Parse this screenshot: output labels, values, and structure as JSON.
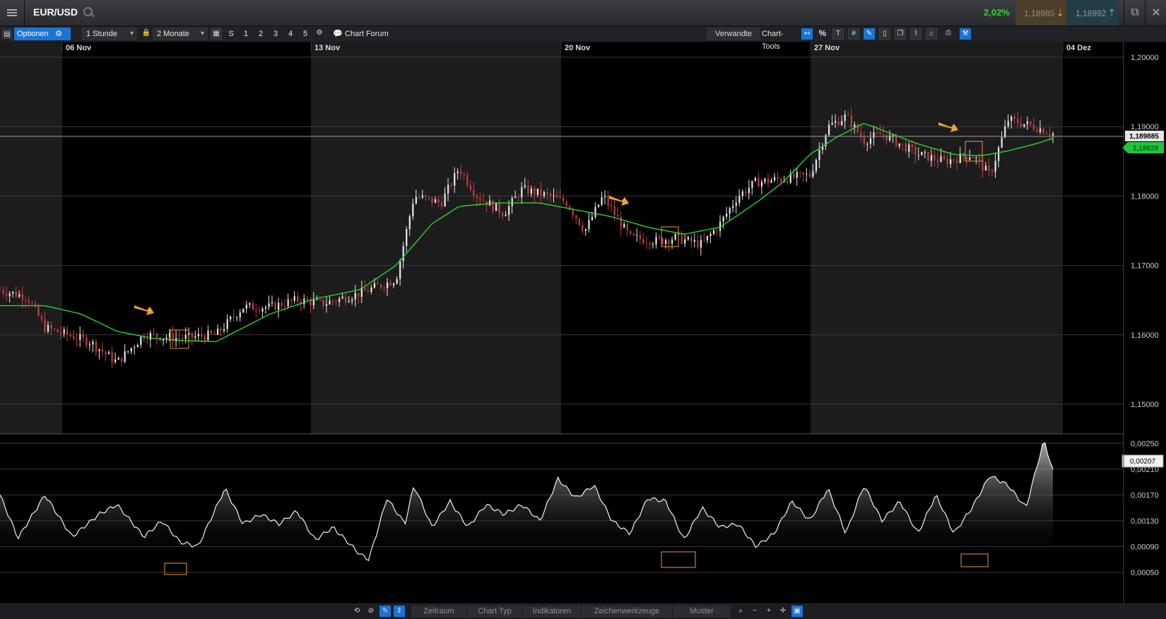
{
  "header": {
    "symbol": "EUR/USD",
    "change_pct": "2,02%",
    "bid": "1,18985",
    "ask": "1,18992"
  },
  "toolbar": {
    "options_label": "Optionen",
    "interval": "1 Stunde",
    "range": "2 Monate",
    "quick_ranges": [
      "S",
      "1",
      "2",
      "3",
      "4",
      "5"
    ],
    "chart_forum": "Chart Forum",
    "related": "Verwandte",
    "chart_tools": "Chart-Tools"
  },
  "bottom": {
    "tabs": [
      "Zeitraum",
      "Chart Typ",
      "Indikatoren",
      "Zeichenwerkzeuge",
      "Muster"
    ]
  },
  "colors": {
    "ma_line": "#2bd42b",
    "up_candle": "#e8e8e8",
    "down_candle": "#c2403f",
    "highlight_box": "#e89a3a",
    "arrow": "#f0a030",
    "accent_blue": "#1a74d6"
  },
  "chart_data": [
    {
      "type": "candlestick",
      "x_ticks": [
        "06 Nov",
        "13 Nov",
        "20 Nov",
        "27 Nov",
        "04 Dez"
      ],
      "y_ticks": [
        "1,20000",
        "1,19000",
        "1,18000",
        "1,17000",
        "1,16000",
        "1,15000"
      ],
      "ylim": [
        1.15,
        1.2
      ],
      "current_price_label": "1,189885",
      "ma_value_label": "1,18829",
      "series": [
        {
          "name": "",
          "approx_path": [
            [
              0,
              1.1664
            ],
            [
              0.03,
              1.1655
            ],
            [
              0.05,
              1.161
            ],
            [
              0.1,
              1.159
            ],
            [
              0.13,
              1.156
            ],
            [
              0.16,
              1.16
            ],
            [
              0.2,
              1.1595
            ],
            [
              0.24,
              1.16
            ],
            [
              0.27,
              1.164
            ],
            [
              0.3,
              1.164
            ],
            [
              0.33,
              1.165
            ],
            [
              0.36,
              1.1645
            ],
            [
              0.4,
              1.166
            ],
            [
              0.44,
              1.168
            ],
            [
              0.46,
              1.18
            ],
            [
              0.49,
              1.179
            ],
            [
              0.51,
              1.184
            ],
            [
              0.53,
              1.18
            ],
            [
              0.56,
              1.1775
            ],
            [
              0.58,
              1.181
            ],
            [
              0.61,
              1.18
            ],
            [
              0.63,
              1.179
            ],
            [
              0.65,
              1.175
            ],
            [
              0.67,
              1.18
            ],
            [
              0.7,
              1.174
            ],
            [
              0.73,
              1.1735
            ],
            [
              0.75,
              1.174
            ],
            [
              0.78,
              1.173
            ],
            [
              0.8,
              1.176
            ],
            [
              0.82,
              1.18
            ],
            [
              0.84,
              1.182
            ],
            [
              0.87,
              1.1825
            ],
            [
              0.9,
              1.183
            ],
            [
              0.92,
              1.19
            ],
            [
              0.94,
              1.1915
            ],
            [
              0.96,
              1.188
            ],
            [
              0.98,
              1.189
            ],
            [
              1.0,
              1.1875
            ],
            [
              1.02,
              1.186
            ],
            [
              1.05,
              1.185
            ],
            [
              1.08,
              1.186
            ],
            [
              1.1,
              1.183
            ],
            [
              1.12,
              1.191
            ],
            [
              1.15,
              1.19
            ],
            [
              1.17,
              1.189
            ]
          ]
        }
      ],
      "ma_path": [
        [
          0,
          1.1642
        ],
        [
          0.05,
          1.1642
        ],
        [
          0.09,
          1.163
        ],
        [
          0.13,
          1.1605
        ],
        [
          0.17,
          1.1595
        ],
        [
          0.2,
          1.1592
        ],
        [
          0.24,
          1.159
        ],
        [
          0.27,
          1.161
        ],
        [
          0.3,
          1.163
        ],
        [
          0.35,
          1.1652
        ],
        [
          0.4,
          1.1665
        ],
        [
          0.44,
          1.17
        ],
        [
          0.48,
          1.176
        ],
        [
          0.51,
          1.1785
        ],
        [
          0.55,
          1.179
        ],
        [
          0.6,
          1.179
        ],
        [
          0.64,
          1.178
        ],
        [
          0.68,
          1.177
        ],
        [
          0.72,
          1.1755
        ],
        [
          0.76,
          1.1745
        ],
        [
          0.8,
          1.1755
        ],
        [
          0.84,
          1.179
        ],
        [
          0.87,
          1.182
        ],
        [
          0.9,
          1.186
        ],
        [
          0.93,
          1.1885
        ],
        [
          0.96,
          1.1905
        ],
        [
          0.99,
          1.189
        ],
        [
          1.02,
          1.1875
        ],
        [
          1.06,
          1.186
        ],
        [
          1.09,
          1.1858
        ],
        [
          1.12,
          1.1865
        ],
        [
          1.15,
          1.1875
        ],
        [
          1.17,
          1.1883
        ]
      ]
    },
    {
      "type": "area",
      "y_ticks": [
        "0,00250",
        "0,00210",
        "0,00170",
        "0,00130",
        "0,00090",
        "0,00050"
      ],
      "ylim": [
        0.0005,
        0.0027
      ],
      "current_value_label": "0,00207",
      "series": [
        {
          "name": "",
          "approx_path": [
            [
              0,
              0.0017
            ],
            [
              0.02,
              0.00103
            ],
            [
              0.05,
              0.0017
            ],
            [
              0.08,
              0.00105
            ],
            [
              0.11,
              0.0014
            ],
            [
              0.13,
              0.00155
            ],
            [
              0.16,
              0.00105
            ],
            [
              0.18,
              0.0013
            ],
            [
              0.2,
              0.00097
            ],
            [
              0.22,
              0.0009
            ],
            [
              0.25,
              0.0018
            ],
            [
              0.27,
              0.00125
            ],
            [
              0.29,
              0.0014
            ],
            [
              0.31,
              0.00125
            ],
            [
              0.33,
              0.00145
            ],
            [
              0.35,
              0.001
            ],
            [
              0.37,
              0.0012
            ],
            [
              0.4,
              0.00078
            ],
            [
              0.41,
              0.0007
            ],
            [
              0.43,
              0.00165
            ],
            [
              0.45,
              0.00125
            ],
            [
              0.46,
              0.00185
            ],
            [
              0.48,
              0.0012
            ],
            [
              0.5,
              0.0016
            ],
            [
              0.52,
              0.0012
            ],
            [
              0.54,
              0.00155
            ],
            [
              0.56,
              0.0014
            ],
            [
              0.58,
              0.00155
            ],
            [
              0.6,
              0.0013
            ],
            [
              0.62,
              0.00195
            ],
            [
              0.64,
              0.00165
            ],
            [
              0.66,
              0.00185
            ],
            [
              0.68,
              0.0013
            ],
            [
              0.7,
              0.0011
            ],
            [
              0.72,
              0.00165
            ],
            [
              0.74,
              0.0016
            ],
            [
              0.76,
              0.001
            ],
            [
              0.78,
              0.0015
            ],
            [
              0.8,
              0.0012
            ],
            [
              0.82,
              0.00125
            ],
            [
              0.84,
              0.0009
            ],
            [
              0.86,
              0.0011
            ],
            [
              0.88,
              0.0016
            ],
            [
              0.9,
              0.0013
            ],
            [
              0.92,
              0.0018
            ],
            [
              0.94,
              0.0011
            ],
            [
              0.96,
              0.00185
            ],
            [
              0.98,
              0.0013
            ],
            [
              1.0,
              0.0016
            ],
            [
              1.02,
              0.0011
            ],
            [
              1.04,
              0.0017
            ],
            [
              1.06,
              0.0011
            ],
            [
              1.08,
              0.0015
            ],
            [
              1.1,
              0.002
            ],
            [
              1.12,
              0.00185
            ],
            [
              1.14,
              0.0015
            ],
            [
              1.16,
              0.00255
            ],
            [
              1.17,
              0.00207
            ]
          ]
        }
      ]
    }
  ]
}
